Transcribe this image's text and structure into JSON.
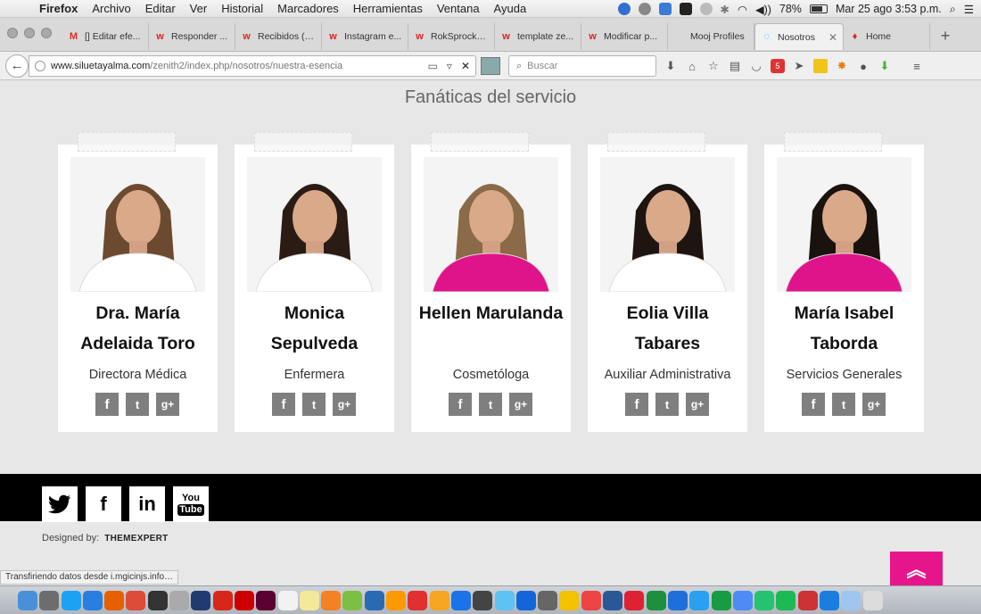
{
  "menubar": {
    "app": "Firefox",
    "items": [
      "Archivo",
      "Editar",
      "Ver",
      "Historial",
      "Marcadores",
      "Herramientas",
      "Ventana",
      "Ayuda"
    ],
    "battery": "78%",
    "battery_level": 0.78,
    "clock": "Mar 25 ago  3:53 p.m."
  },
  "tabs": [
    {
      "label": "[] Editar efe...",
      "icon": "gmail-icon",
      "color": "#d93025",
      "glyph": "M"
    },
    {
      "label": "Responder ...",
      "icon": "w-icon",
      "color": "#d22",
      "glyph": "w"
    },
    {
      "label": "Recibidos (1...",
      "icon": "w-icon",
      "color": "#d22",
      "glyph": "w"
    },
    {
      "label": "Instagram e...",
      "icon": "w-icon",
      "color": "#d22",
      "glyph": "w"
    },
    {
      "label": "RokSprocke...",
      "icon": "w-icon",
      "color": "#d22",
      "glyph": "w"
    },
    {
      "label": "template ze...",
      "icon": "w-icon",
      "color": "#d22",
      "glyph": "w"
    },
    {
      "label": "Modificar p...",
      "icon": "w-icon",
      "color": "#d22",
      "glyph": "w"
    },
    {
      "label": "Mooj Profiles",
      "icon": "blank-icon",
      "color": "#999",
      "glyph": ""
    },
    {
      "label": "Nosotros",
      "icon": "loading-icon",
      "color": "#3a8ee6",
      "glyph": "◌",
      "active": true
    },
    {
      "label": "Home",
      "icon": "drop-icon",
      "color": "#d22",
      "glyph": "♦"
    }
  ],
  "nav": {
    "url_host": "www.siluetayalma.com",
    "url_path": "/zenith2/index.php/nosotros/nuestra-esencia",
    "search_placeholder": "Buscar"
  },
  "page": {
    "section_title": "Fanáticas del servicio",
    "team": [
      {
        "name": "Dra. María Adelaida Toro",
        "role": "Directora Médica",
        "top": "#ffffff",
        "hair": "#6b4a2f"
      },
      {
        "name": "Monica Sepulveda",
        "role": "Enfermera",
        "top": "#ffffff",
        "hair": "#2a1c14"
      },
      {
        "name": "Hellen Marulanda",
        "role": "Cosmetóloga",
        "top": "#e0148a",
        "hair": "#8a6a48"
      },
      {
        "name": "Eolia Villa Tabares",
        "role": "Auxiliar Administrativa",
        "top": "#ffffff",
        "hair": "#1e1410"
      },
      {
        "name": "María Isabel Taborda",
        "role": "Servicios Generales",
        "top": "#e0148a",
        "hair": "#1a120d"
      }
    ],
    "social_labels": {
      "facebook": "f",
      "twitter": "t",
      "googleplus": "g+"
    }
  },
  "footer": {
    "designed_by": "Designed by:",
    "brand": "THEMEXPERT",
    "youtube_top": "You",
    "youtube_bottom": "Tube",
    "linkedin": "in",
    "facebook": "f"
  },
  "status": "Transfiriendo datos desde i.mgicinjs.info…",
  "colors": {
    "accent": "#e6158b",
    "footer": "#000000",
    "social_grey": "#7f7f7f"
  },
  "dock": [
    "#4a90d9",
    "#6d6d6d",
    "#1da1f2",
    "#2a7de1",
    "#e66000",
    "#dd4b39",
    "#333",
    "#aaa",
    "#1f3b6f",
    "#d8261a",
    "#c00",
    "#5b0030",
    "#f2f2f2",
    "#f4e99a",
    "#f58220",
    "#7cc043",
    "#2a6ab3",
    "#ff9900",
    "#e03030",
    "#f5a623",
    "#1a73e8",
    "#444",
    "#5ec2f2",
    "#1466d8",
    "#666",
    "#f2c200",
    "#ee4444",
    "#2b5797",
    "#d23",
    "#1d8f3f",
    "#1e6fd9",
    "#2aa0f0",
    "#199b45",
    "#4c8cf5",
    "#26c26f",
    "#1db954",
    "#c33",
    "#1a7de0",
    "#9ec6ee",
    "#dcdcdc"
  ]
}
